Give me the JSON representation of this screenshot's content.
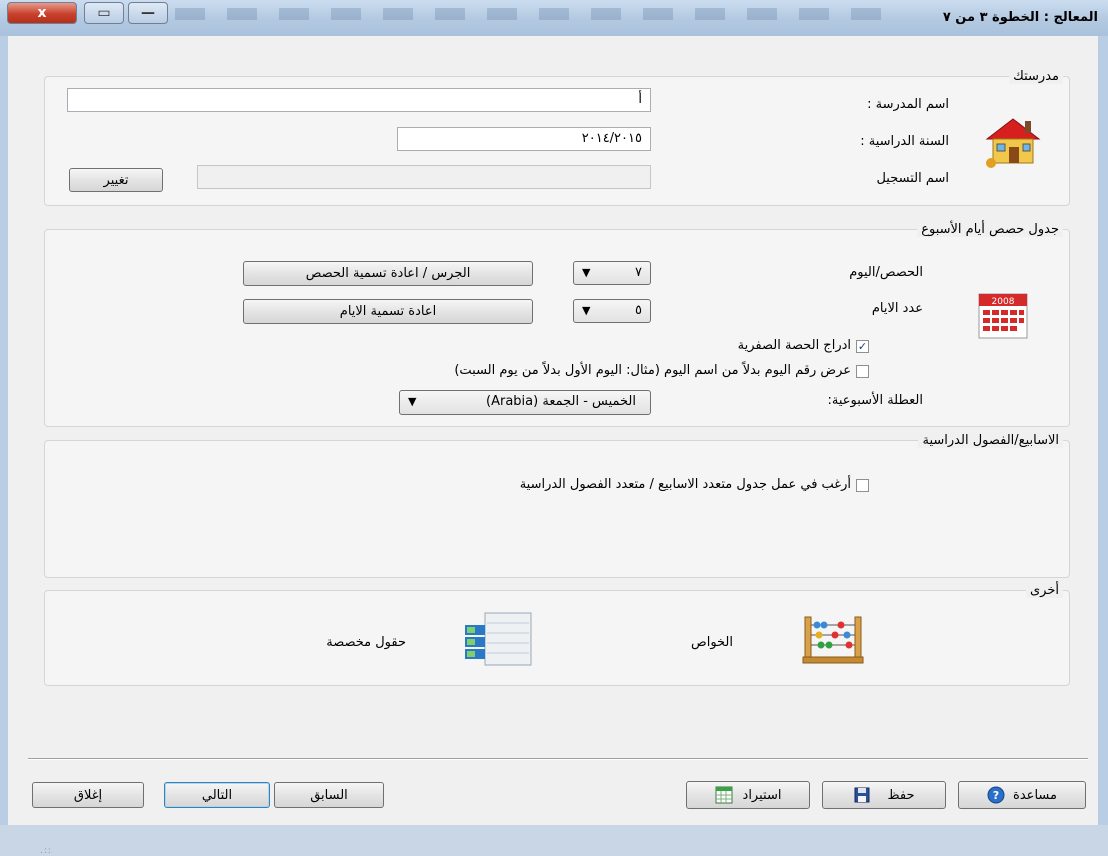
{
  "window": {
    "title": "المعالج : الخطوة ٣ من ٧",
    "close_glyph": "x",
    "max_glyph": "▭",
    "min_glyph": "—"
  },
  "school": {
    "legend": "مدرستك",
    "name_label": "اسم المدرسة :",
    "name_value": "أ",
    "year_label": "السنة الدراسية :",
    "year_value": "٢٠١٤/٢٠١٥",
    "registration_label": "اسم التسجيل",
    "registration_value": "",
    "change_button": "تغيير",
    "icon": "house-icon"
  },
  "schedule": {
    "legend": "جدول حصص أيام الأسبوع",
    "periods_label": "الحصص/اليوم",
    "periods_value": "٧",
    "bell_button": "الجرس / اعادة تسمية الحصص",
    "days_label": "عدد الايام",
    "days_value": "٥",
    "rename_days_button": "اعادة تسمية الايام",
    "zero_period_label": "ادراج الحصة الصفرية",
    "zero_period_checked": true,
    "day_number_label": "عرض رقم اليوم بدلاً من اسم اليوم (مثال: اليوم الأول بدلاً من يوم السبت)",
    "day_number_checked": false,
    "weekend_label": "العطلة الأسبوعية:",
    "weekend_value": "الخميس - الجمعة (Arabia)",
    "icon": "calendar-icon"
  },
  "terms": {
    "legend": "الاسابيع/الفصول الدراسية",
    "multi_label": "أرغب في عمل جدول متعدد الاسابيع / متعدد الفصول الدراسية",
    "multi_checked": false
  },
  "other": {
    "legend": "أخرى",
    "properties_label": "الخواص",
    "custom_fields_label": "حقول مخصصة"
  },
  "footer": {
    "help": "مساعدة",
    "save": "حفظ",
    "import": "استيراد",
    "previous": "السابق",
    "next": "التالي",
    "close": "إغلاق"
  },
  "check_glyph": "✓",
  "arrow_glyph": "▼"
}
